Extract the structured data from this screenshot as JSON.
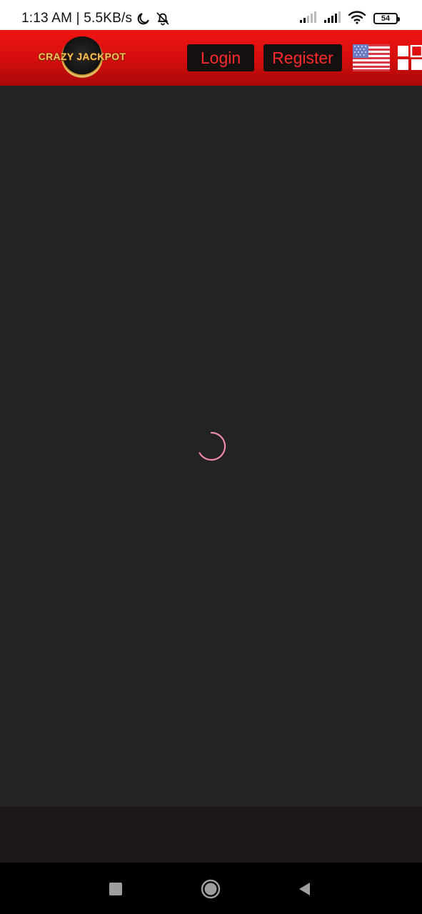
{
  "status_bar": {
    "time": "1:13 AM | 5.5KB/s",
    "battery": "54",
    "icons": [
      "moon-icon",
      "bell-off-icon",
      "signal-icon",
      "signal-icon",
      "wifi-icon",
      "battery-icon"
    ]
  },
  "header": {
    "logo_text": "CRAZY JACKPOT",
    "login_label": "Login",
    "register_label": "Register",
    "language_icon": "us-flag-icon",
    "menu_icon": "grid-menu-icon",
    "colors": {
      "header_red": "#e01010",
      "button_bg": "#141010",
      "button_text": "#ff2b2b",
      "logo_gold": "#f6c25a"
    }
  },
  "main": {
    "state": "loading",
    "spinner_icon": "loading-spinner-icon",
    "spinner_color": "#f08aa8",
    "background": "#232325"
  },
  "nav_bar": {
    "icons": [
      "recent-apps-icon",
      "home-icon",
      "back-icon"
    ]
  }
}
